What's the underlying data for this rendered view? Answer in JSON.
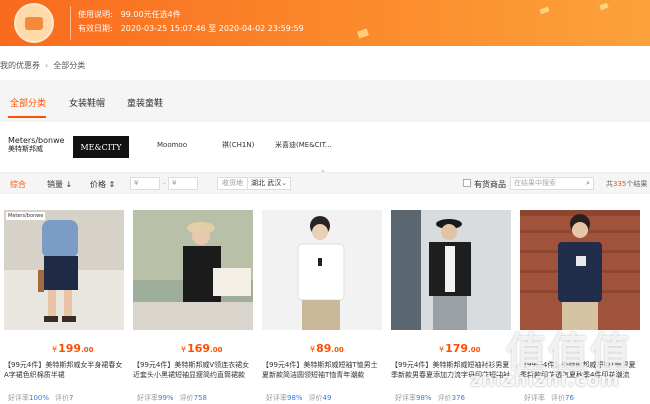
{
  "coupon": {
    "usage_label": "使用说明:",
    "usage_value": "99.00元任选4件",
    "valid_label": "有效日期:",
    "valid_value": "2020-03-25 15:07:46 至 2020-04-02 23:59:59"
  },
  "breadcrumb": {
    "root": "我的优惠券",
    "current": "全部分类"
  },
  "categories": [
    {
      "label": "全部分类",
      "active": true
    },
    {
      "label": "女装鞋帽",
      "active": false
    },
    {
      "label": "童装童鞋",
      "active": false
    }
  ],
  "brands": [
    {
      "line1": "Meters/bonwe",
      "line2": "美特斯邦威"
    },
    {
      "label": "ME&CITY"
    },
    {
      "label": "Moomoo"
    },
    {
      "label": "祺(CH1N)"
    },
    {
      "label": "米喜迪(ME&CIT..."
    }
  ],
  "brand_more": "⌄",
  "filters": {
    "sort_default": "综合",
    "sort_sales": "销量 ↓",
    "sort_price": "价格 ⇕",
    "price_min_placeholder": "¥",
    "price_max_placeholder": "¥",
    "ship_label": "收货地",
    "ship_value": "湖北 武汉",
    "in_stock_label": "有货商品",
    "search_placeholder": "在结果中搜索",
    "total_prefix": "共",
    "total_count": "335",
    "total_suffix": "个结果"
  },
  "products": [
    {
      "brand_tag": "Meters/bonwe",
      "price_int": "199",
      "price_dec": ".00",
      "title": "【99元4件】美特斯邦威女半身裙春女A字裙色织棉质半裙",
      "rating_label": "好评率",
      "rating": "100%",
      "reviews_label": "评价",
      "reviews": "7"
    },
    {
      "brand_tag": "",
      "price_int": "169",
      "price_dec": ".00",
      "title": "【99元4件】美特斯邦威V领连衣裙女近套头小黑裙短袖显瘦简约直筒裙款",
      "rating_label": "好评率",
      "rating": "99%",
      "reviews_label": "评价",
      "reviews": "758"
    },
    {
      "brand_tag": "",
      "price_int": "89",
      "price_dec": ".00",
      "title": "【99元4件】美特斯邦威短袖T恤男士夏新款简洁圆领短袖T恤青年潮款",
      "rating_label": "好评率",
      "rating": "98%",
      "reviews_label": "评价",
      "reviews": "49"
    },
    {
      "brand_tag": "",
      "price_int": "179",
      "price_dec": ".00",
      "title": "【99元4件】美特斯邦威短袖衬衫男夏季新款男春夏添加力流字母印花短袖衬衫",
      "rating_label": "好评率",
      "rating": "98%",
      "reviews_label": "评价",
      "reviews": "376"
    },
    {
      "brand_tag": "",
      "price_int": "",
      "price_dec": "",
      "title": "【99元4件】美特斯邦威短袖T恤男夏季新款印花透气夏秋季4件印花潮流",
      "rating_label": "好评率",
      "rating": "",
      "reviews_label": "评价",
      "reviews": "76"
    }
  ],
  "watermark": {
    "big": "值值值",
    "small": "zhizhizhi.com"
  },
  "colors": {
    "accent": "#ff5000",
    "banner": "#fb8a2c",
    "link": "#3a7bd5"
  }
}
